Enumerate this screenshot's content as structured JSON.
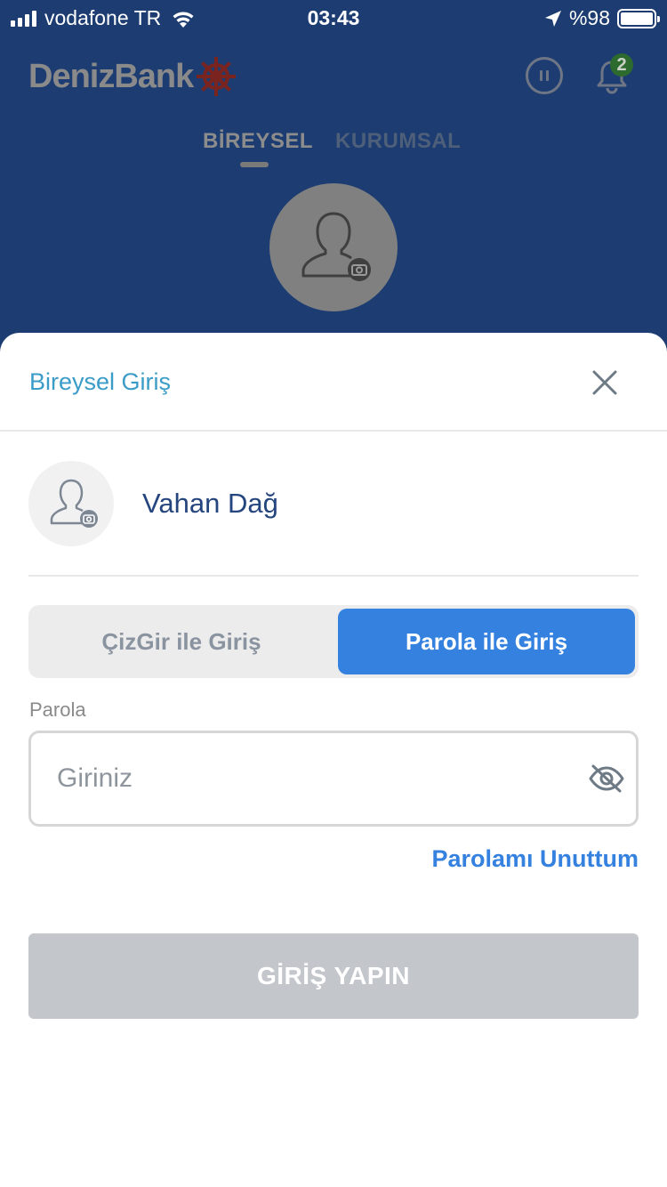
{
  "status_bar": {
    "carrier": "vodafone TR",
    "time": "03:43",
    "battery": "%98",
    "icons": [
      "signal-icon",
      "wifi-icon",
      "location-arrow-icon",
      "battery-icon"
    ]
  },
  "header": {
    "logo_text": "DenizBank",
    "logo_icon": "ship-wheel-icon",
    "notification_count": "2"
  },
  "tabs": [
    {
      "label": "BİREYSEL",
      "active": true
    },
    {
      "label": "KURUMSAL",
      "active": false
    }
  ],
  "sheet": {
    "title": "Bireysel Giriş",
    "user_name": "Vahan Dağ",
    "segment": {
      "left_label": "ÇizGir ile Giriş",
      "right_label": "Parola ile Giriş",
      "selected": "right"
    },
    "password": {
      "label": "Parola",
      "placeholder": "Giriniz",
      "value": ""
    },
    "forgot_label": "Parolamı Unuttum",
    "login_label": "GİRİŞ YAPIN"
  },
  "colors": {
    "backdrop": "#1d3d72",
    "title": "#3a9cc7",
    "accent": "#3581e0",
    "name": "#24457e",
    "disabled_button": "#c3c6cb"
  }
}
